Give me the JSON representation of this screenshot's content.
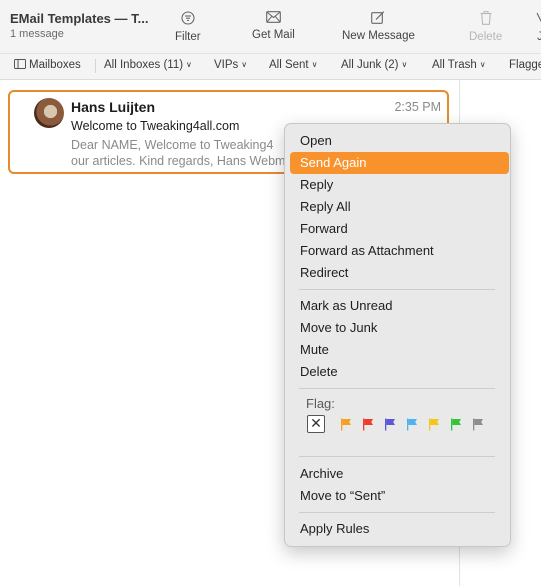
{
  "window": {
    "title": "EMail Templates — T...",
    "subtitle": "1 message"
  },
  "toolbar": {
    "filter": "Filter",
    "get_mail": "Get Mail",
    "new_message": "New Message",
    "delete": "Delete",
    "junk_partial": "J"
  },
  "favorites": {
    "mailboxes": "Mailboxes",
    "all_inboxes": "All Inboxes (11)",
    "vips": "VIPs",
    "all_sent": "All Sent",
    "all_junk": "All Junk (2)",
    "all_trash": "All Trash",
    "flagged": "Flagge"
  },
  "message": {
    "sender": "Hans Luijten",
    "time": "2:35 PM",
    "subject": "Welcome to Tweaking4all.com",
    "preview_line1": "Dear NAME, Welcome to Tweaking4",
    "preview_line2": "our articles. Kind regards, Hans Webm"
  },
  "context_menu": {
    "open": "Open",
    "send_again": "Send Again",
    "reply": "Reply",
    "reply_all": "Reply All",
    "forward": "Forward",
    "forward_attachment": "Forward as Attachment",
    "redirect": "Redirect",
    "mark_unread": "Mark as Unread",
    "move_junk": "Move to Junk",
    "mute": "Mute",
    "delete": "Delete",
    "flag_label": "Flag:",
    "flag_clear": "✕",
    "archive": "Archive",
    "move_sent": "Move to “Sent”",
    "apply_rules": "Apply Rules"
  },
  "flag_colors": [
    "#f5a020",
    "#ef3b2c",
    "#5b57d6",
    "#4fb3ee",
    "#f5c518",
    "#34c43a",
    "#8e8e8e"
  ],
  "colors": {
    "accent": "#f7922d",
    "selection_border": "#e68a2e"
  }
}
